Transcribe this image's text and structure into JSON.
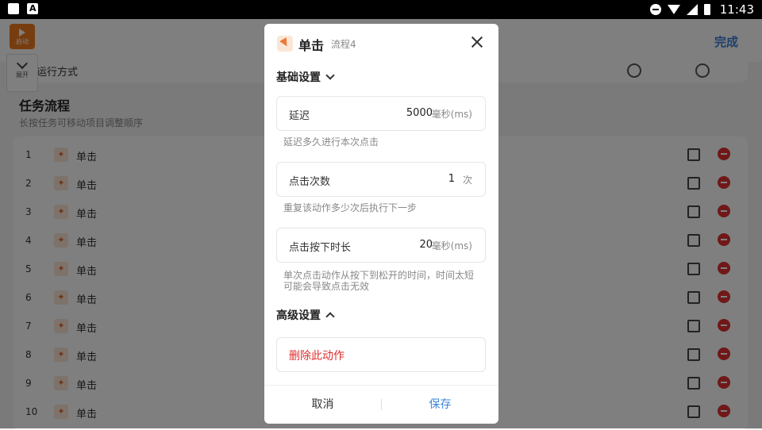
{
  "status_bar": {
    "time": "11:43"
  },
  "background": {
    "launch_label": "启动",
    "expand_label": "展开",
    "done_label": "完成",
    "mode_label": "运行方式",
    "section_title": "任务流程",
    "section_subtitle": "长按任务可移动项目调整顺序",
    "tasks": [
      {
        "num": "1",
        "name": "单击"
      },
      {
        "num": "2",
        "name": "单击"
      },
      {
        "num": "3",
        "name": "单击"
      },
      {
        "num": "4",
        "name": "单击"
      },
      {
        "num": "5",
        "name": "单击"
      },
      {
        "num": "6",
        "name": "单击"
      },
      {
        "num": "7",
        "name": "单击"
      },
      {
        "num": "8",
        "name": "单击"
      },
      {
        "num": "9",
        "name": "单击"
      },
      {
        "num": "10",
        "name": "单击"
      }
    ]
  },
  "dialog": {
    "title": "单击",
    "subtitle": "流程4",
    "basic_section": "基础设置",
    "delay": {
      "label": "延迟",
      "value": "5000",
      "unit": "毫秒(ms)",
      "hint": "延迟多久进行本次点击"
    },
    "count": {
      "label": "点击次数",
      "value": "1",
      "unit": "次",
      "hint": "重复该动作多少次后执行下一步"
    },
    "press": {
      "label": "点击按下时长",
      "value": "20",
      "unit": "毫秒(ms)",
      "hint": "单次点击动作从按下到松开的时间，时间太短可能会导致点击无效"
    },
    "advanced_section": "高级设置",
    "delete_label": "删除此动作",
    "cancel_label": "取消",
    "save_label": "保存"
  },
  "colors": {
    "accent": "#3d86d8",
    "danger": "#e02d2d",
    "brand": "#f07a1e"
  }
}
